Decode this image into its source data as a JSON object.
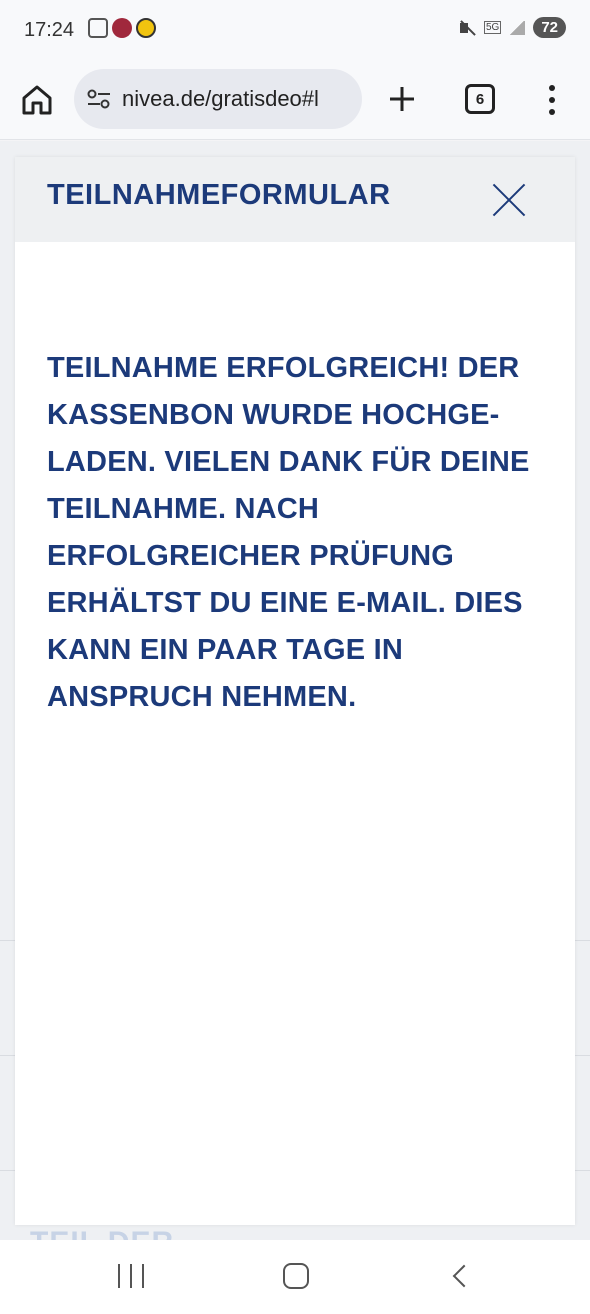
{
  "status_bar": {
    "time": "17:24",
    "data_badge": "5G",
    "battery": "72"
  },
  "browser": {
    "url": "nivea.de/gratisdeo#l",
    "tab_count": "6"
  },
  "modal": {
    "title": "TEILNAHMEFORMULAR",
    "message": "TEILNAHME ERFOLGREICH! DER KASSENBON WURDE HOCHGE-LADEN. VIELEN DANK FÜR DEINE TEILNAHME. NACH ERFOLGREICHER PRÜFUNG ERHÄLTST DU EINE E-MAIL. DIES KANN EIN PAAR TAGE IN ANSPRUCH NEHMEN."
  },
  "background_page": {
    "peek_text": "TEIL DER"
  },
  "colors": {
    "brand_blue": "#1c3a7a",
    "header_gray": "#eef0f2"
  }
}
